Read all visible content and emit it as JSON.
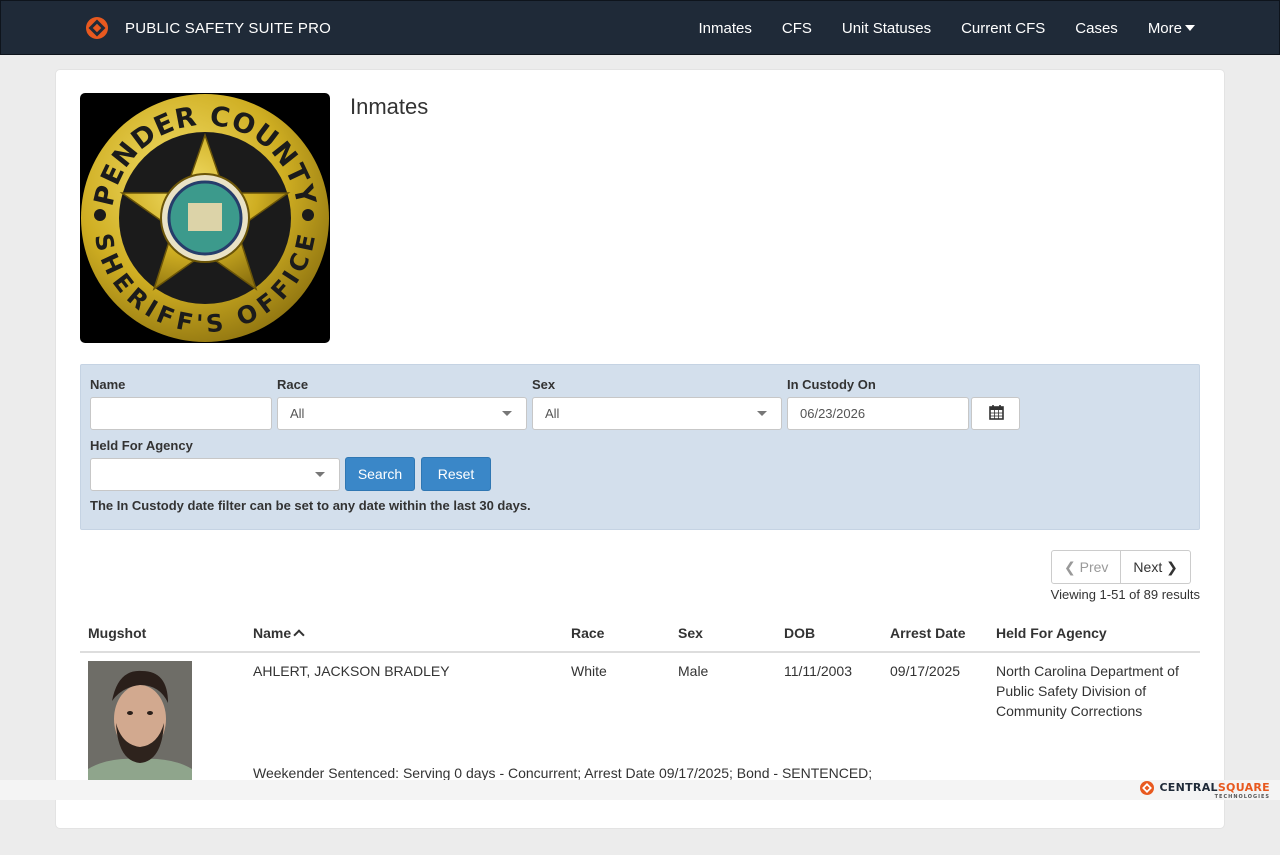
{
  "app": {
    "brand": "PUBLIC SAFETY SUITE PRO"
  },
  "nav": {
    "items": [
      "Inmates",
      "CFS",
      "Unit Statuses",
      "Current CFS",
      "Cases"
    ],
    "more": "More"
  },
  "page": {
    "title": "Inmates"
  },
  "filters": {
    "name_label": "Name",
    "name_value": "",
    "race_label": "Race",
    "race_value": "All",
    "sex_label": "Sex",
    "sex_value": "All",
    "custody_label": "In Custody On",
    "custody_value": "06/23/2026",
    "agency_label": "Held For Agency",
    "agency_value": "",
    "search_label": "Search",
    "reset_label": "Reset",
    "note": "The In Custody date filter can be set to any date within the last 30 days."
  },
  "pager": {
    "prev": "Prev",
    "next": "Next",
    "viewing": "Viewing 1-51 of 89 results"
  },
  "table": {
    "headers": [
      "Mugshot",
      "Name",
      "Race",
      "Sex",
      "DOB",
      "Arrest Date",
      "Held For Agency"
    ],
    "rows": [
      {
        "name": "AHLERT, JACKSON BRADLEY",
        "race": "White",
        "sex": "Male",
        "dob": "11/11/2003",
        "arrest_date": "09/17/2025",
        "agency": "North Carolina Department of Public Safety Division of Community Corrections",
        "charges": "Weekender Sentenced: Serving 0 days - Concurrent; Arrest Date 09/17/2025; Bond - SENTENCED;"
      }
    ]
  },
  "badge": {
    "top_text": "PENDER COUNTY",
    "bottom_text": "SHERIFF'S OFFICE",
    "gold": "#d4b62b",
    "black": "#000000"
  },
  "footer": {
    "logo_a": "CENTRAL",
    "logo_b": "SQUARE",
    "logo_sub": "TECHNOLOGIES"
  },
  "colors": {
    "navbar": "#1f2a38",
    "filter_bg": "#d3dfec",
    "button": "#3a87c8",
    "accent_orange": "#e8591f"
  }
}
